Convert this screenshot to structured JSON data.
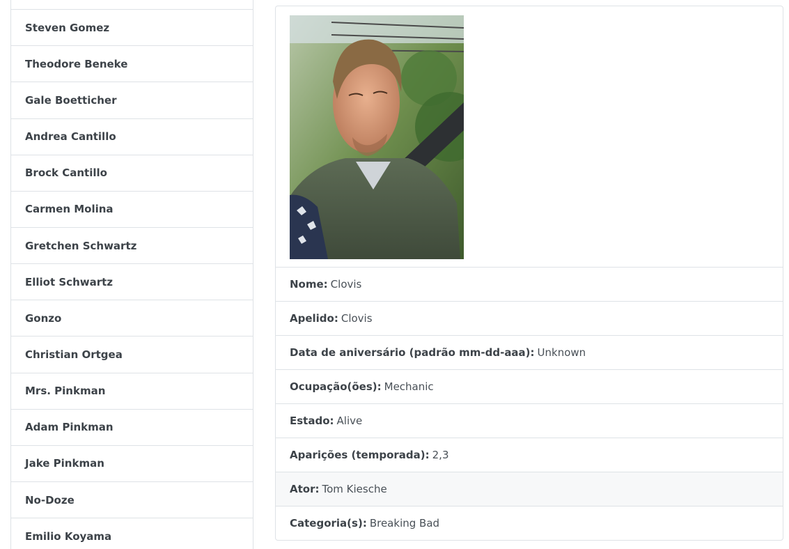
{
  "characters": [
    "",
    "Steven Gomez",
    "Theodore Beneke",
    "Gale Boetticher",
    "Andrea Cantillo",
    "Brock Cantillo",
    "Carmen Molina",
    "Gretchen Schwartz",
    "Elliot Schwartz",
    "Gonzo",
    "Christian Ortgea",
    "Mrs. Pinkman",
    "Adam Pinkman",
    "Jake Pinkman",
    "No-Doze",
    "Emilio Koyama"
  ],
  "detail": {
    "photo_icon": "character-portrait",
    "fields": [
      {
        "label": "Nome:",
        "value": "Clovis"
      },
      {
        "label": "Apelido:",
        "value": "Clovis"
      },
      {
        "label": "Data de aniversário (padrão mm-dd-aaa):",
        "value": "Unknown"
      },
      {
        "label": "Ocupação(ões):",
        "value": "Mechanic"
      },
      {
        "label": "Estado:",
        "value": "Alive"
      },
      {
        "label": "Aparições (temporada):",
        "value": "2,3"
      },
      {
        "label": "Ator:",
        "value": "Tom Kiesche"
      },
      {
        "label": "Categoria(s):",
        "value": "Breaking Bad"
      }
    ],
    "highlight_row_color": "#f7f8f9"
  }
}
